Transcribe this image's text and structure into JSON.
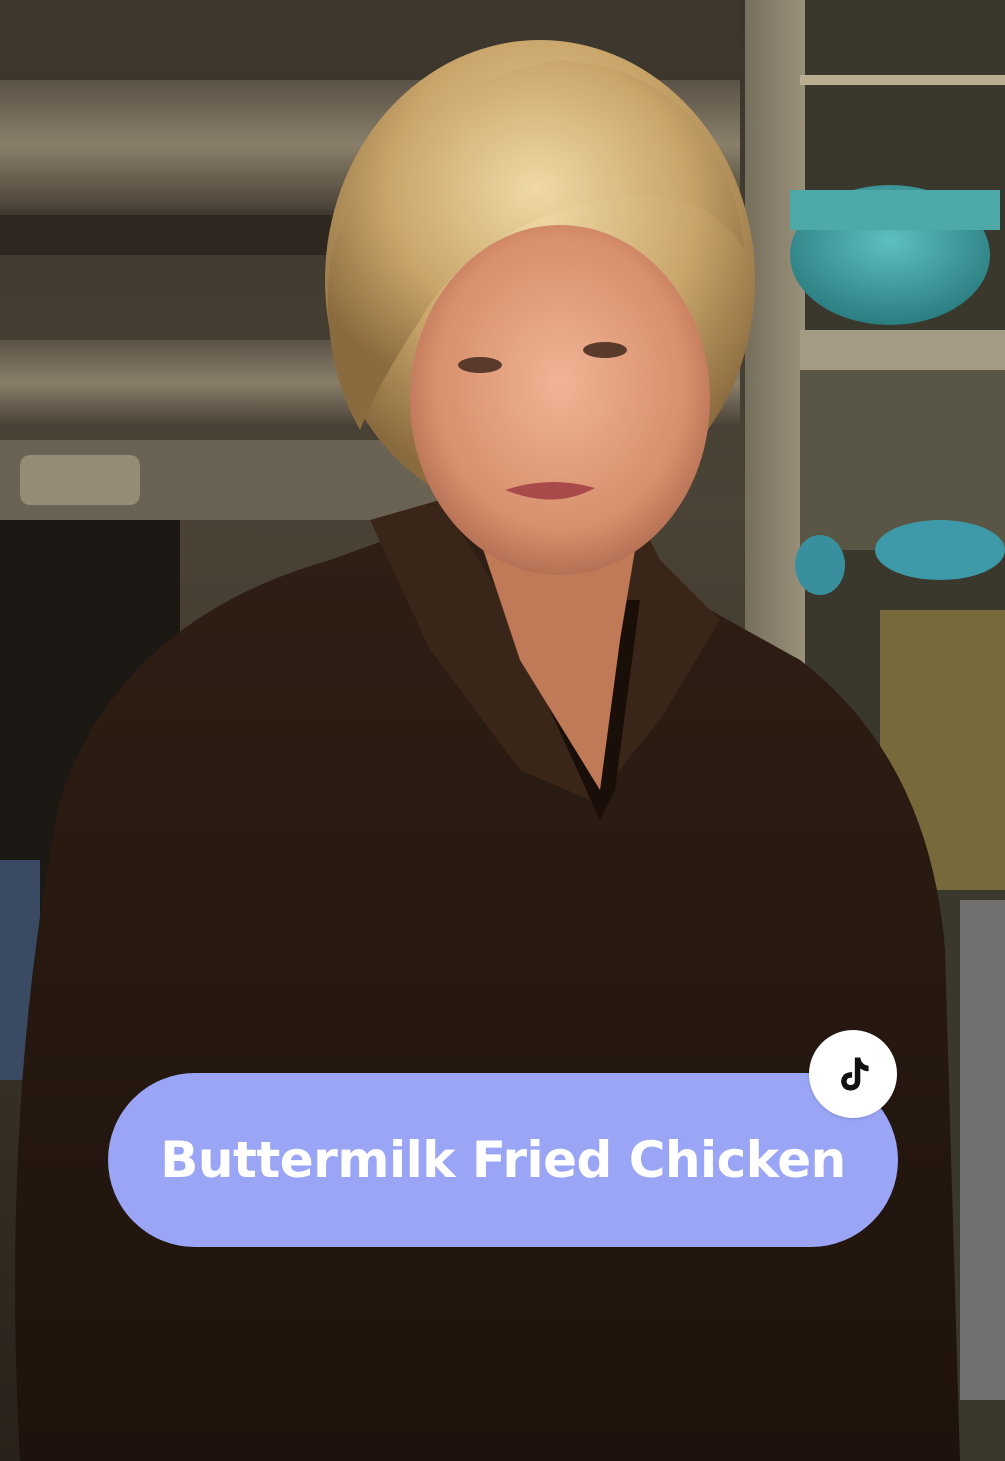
{
  "video": {
    "scene_description_icon": "video-frame",
    "caption": {
      "text": "Buttermilk Fried Chicken",
      "background_color": "#9aa6f5",
      "text_color": "#ffffff"
    },
    "badge": {
      "icon": "tiktok-logo-icon",
      "background_color": "#ffffff",
      "icon_color": "#111111"
    }
  }
}
